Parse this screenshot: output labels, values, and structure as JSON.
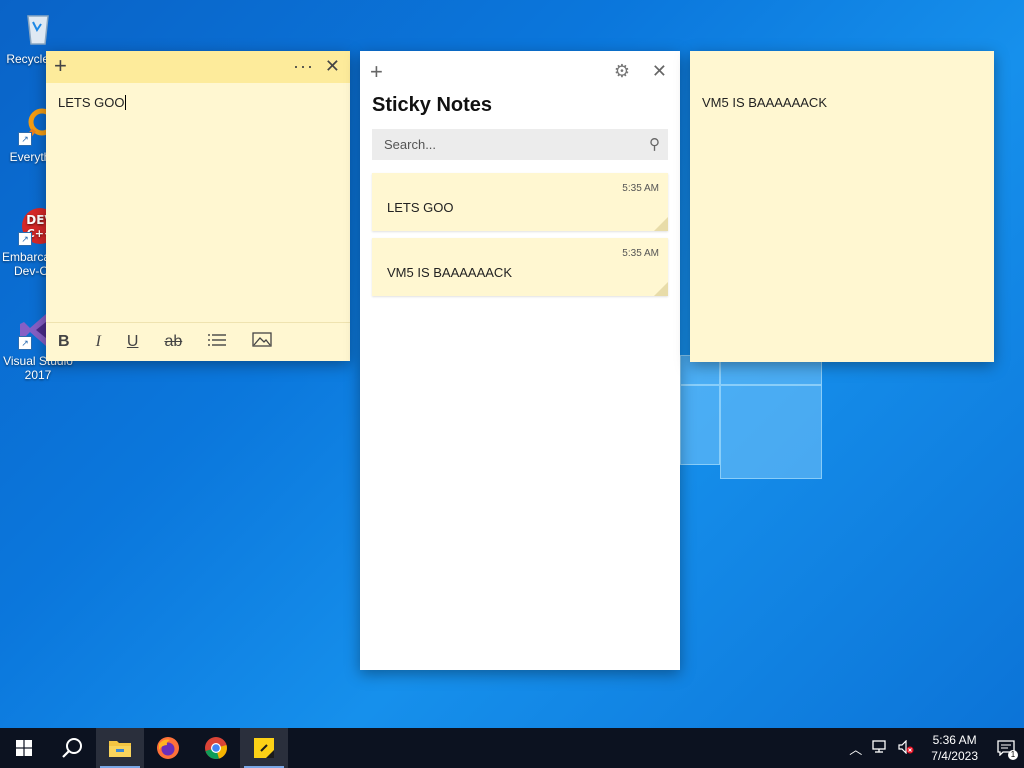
{
  "desktop": {
    "icons": [
      {
        "label": "Recycle Bin",
        "icon": "recycle-bin-icon"
      },
      {
        "label": "Everything",
        "icon": "everything-search-icon"
      },
      {
        "label": "Embarcadero Dev-C++",
        "icon": "devcpp-icon"
      },
      {
        "label": "Visual Studio 2017",
        "icon": "visual-studio-icon"
      }
    ]
  },
  "note_left": {
    "text": "LETS GOO",
    "toolbar": {
      "bold": "B",
      "italic": "I",
      "underline": "U",
      "strike": "ab"
    }
  },
  "list_window": {
    "title": "Sticky Notes",
    "search_placeholder": "Search...",
    "notes": [
      {
        "time": "5:35 AM",
        "text": "LETS GOO"
      },
      {
        "time": "5:35 AM",
        "text": "VM5 IS BAAAAAACK"
      }
    ]
  },
  "note_right": {
    "text": "VM5 IS BAAAAAACK"
  },
  "taskbar": {
    "apps": [
      "start",
      "search",
      "file-explorer",
      "firefox",
      "chrome",
      "sticky-notes"
    ],
    "clock": {
      "time": "5:36 AM",
      "date": "7/4/2023"
    },
    "notification_count": "1"
  },
  "colors": {
    "note_body": "#fff7d1",
    "note_header": "#fdeb9b",
    "taskbar": "#0c1220"
  }
}
